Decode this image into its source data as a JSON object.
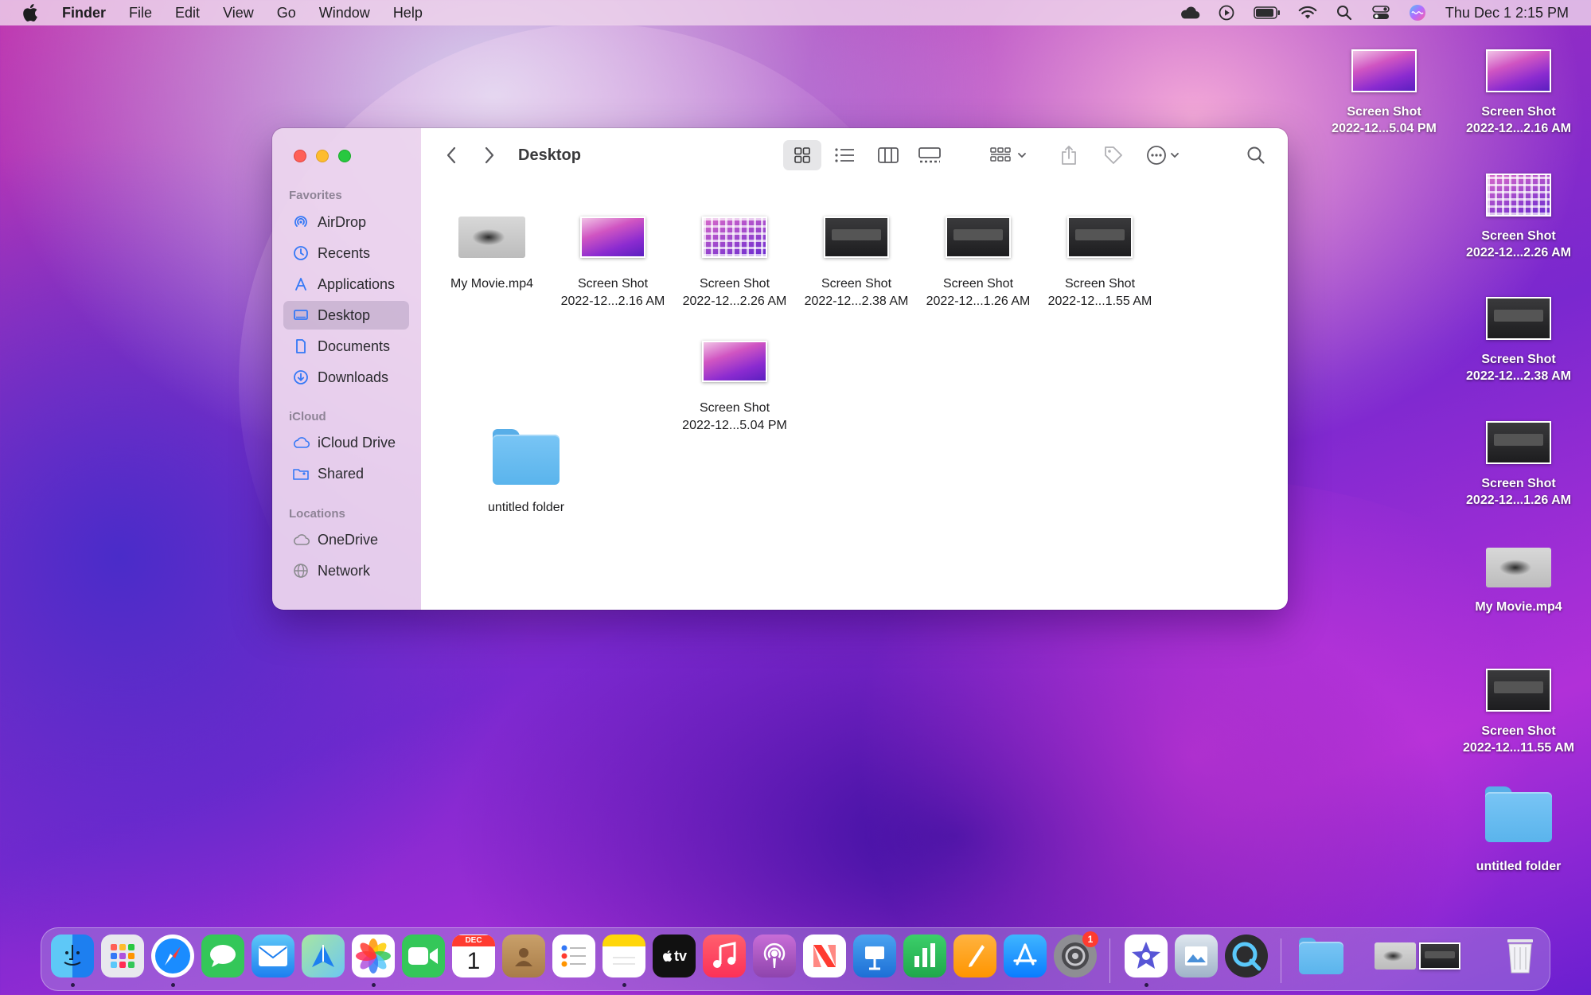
{
  "menubar": {
    "apple_icon": "apple-icon",
    "app_name": "Finder",
    "menus": [
      "File",
      "Edit",
      "View",
      "Go",
      "Window",
      "Help"
    ],
    "status_icons": [
      "icloud-icon",
      "play-icon",
      "battery-icon",
      "wifi-icon",
      "search-icon",
      "control-center-icon",
      "siri-icon"
    ],
    "clock": "Thu Dec 1  2:15 PM"
  },
  "finder": {
    "title": "Desktop",
    "sidebar": {
      "favorites_header": "Favorites",
      "favorites": [
        {
          "label": "AirDrop",
          "icon": "airdrop-icon"
        },
        {
          "label": "Recents",
          "icon": "clock-icon"
        },
        {
          "label": "Applications",
          "icon": "applications-icon"
        },
        {
          "label": "Desktop",
          "icon": "desktop-icon",
          "selected": true
        },
        {
          "label": "Documents",
          "icon": "document-icon"
        },
        {
          "label": "Downloads",
          "icon": "download-icon"
        }
      ],
      "icloud_header": "iCloud",
      "icloud": [
        {
          "label": "iCloud Drive",
          "icon": "cloud-icon"
        },
        {
          "label": "Shared",
          "icon": "shared-folder-icon"
        }
      ],
      "locations_header": "Locations",
      "locations": [
        {
          "label": "OneDrive",
          "icon": "cloud-icon"
        },
        {
          "label": "Network",
          "icon": "globe-icon"
        }
      ]
    },
    "files": [
      {
        "line1": "My Movie.mp4",
        "line2": "",
        "kind": "movie"
      },
      {
        "line1": "Screen Shot",
        "line2": "2022-12...2.16 AM",
        "kind": "pink"
      },
      {
        "line1": "Screen Shot",
        "line2": "2022-12...2.26 AM",
        "kind": "grid"
      },
      {
        "line1": "Screen Shot",
        "line2": "2022-12...2.38 AM",
        "kind": "dark"
      },
      {
        "line1": "Screen Shot",
        "line2": "2022-12...1.26 AM",
        "kind": "dark"
      },
      {
        "line1": "Screen Shot",
        "line2": "2022-12...1.55 AM",
        "kind": "dark"
      },
      {
        "line1": "Screen Shot",
        "line2": "2022-12...5.04 PM",
        "kind": "pink"
      },
      {
        "line1": "untitled folder",
        "line2": "",
        "kind": "folder"
      }
    ]
  },
  "desktop": {
    "items": [
      {
        "line1": "Screen Shot",
        "line2": "2022-12...5.04 PM",
        "kind": "pink"
      },
      {
        "line1": "Screen Shot",
        "line2": "2022-12...2.16 AM",
        "kind": "pink"
      },
      {
        "line1": "Screen Shot",
        "line2": "2022-12...2.26 AM",
        "kind": "grid"
      },
      {
        "line1": "Screen Shot",
        "line2": "2022-12...2.38 AM",
        "kind": "dark"
      },
      {
        "line1": "Screen Shot",
        "line2": "2022-12...1.26 AM",
        "kind": "dark"
      },
      {
        "line1": "My Movie.mp4",
        "line2": "",
        "kind": "movie"
      },
      {
        "line1": "Screen Shot",
        "line2": "2022-12...11.55 AM",
        "kind": "dark"
      },
      {
        "line1": "untitled folder",
        "line2": "",
        "kind": "folder"
      }
    ]
  },
  "dock": {
    "apps": [
      "finder-icon",
      "launchpad-icon",
      "safari-icon",
      "messages-icon",
      "mail-icon",
      "maps-icon",
      "photos-icon",
      "facetime-icon",
      "calendar-icon",
      "contacts-icon",
      "reminders-icon",
      "notes-icon",
      "apple-tv-icon",
      "music-icon",
      "podcasts-icon",
      "news-icon",
      "keynote-icon",
      "numbers-icon",
      "pages-icon",
      "app-store-icon",
      "system-preferences-icon",
      "imovie-icon",
      "preview-icon",
      "quicktime-icon",
      "downloads-stack-icon",
      "recent-stack-icon",
      "trash-icon"
    ],
    "calendar_month": "DEC",
    "calendar_day": "1",
    "tv_label": "tv",
    "settings_badge": "1"
  },
  "colors": {
    "close": "#ff5f57",
    "minimize": "#febc2e",
    "zoom": "#28c840",
    "folder": "#5ab4ec",
    "accent_sidebar_icon": "#3478f6"
  }
}
